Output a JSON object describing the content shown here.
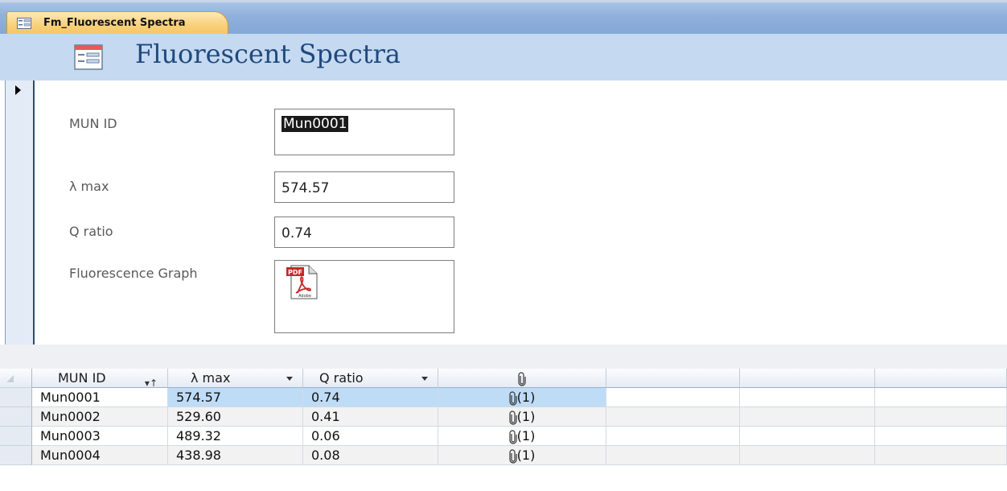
{
  "tab": {
    "label": "Fm_Fluorescent Spectra",
    "icon": "form-icon"
  },
  "header": {
    "title": "Fluorescent Spectra",
    "icon": "form-icon"
  },
  "form": {
    "mun_id": {
      "label": "MUN ID",
      "value": "Mun0001"
    },
    "lambda_max": {
      "label": "λ max",
      "value": "574.57"
    },
    "q_ratio": {
      "label": "Q ratio",
      "value": "0.74"
    },
    "graph": {
      "label": "Fluorescence Graph",
      "attachment_icon": "pdf-icon"
    }
  },
  "datasheet": {
    "columns": [
      "MUN ID",
      "λ max",
      "Q ratio",
      ""
    ],
    "attachment_column_icon": "paperclip-icon",
    "rows": [
      {
        "mun_id": "Mun0001",
        "lambda_max": "574.57",
        "q_ratio": "0.74",
        "attachments": "(1)"
      },
      {
        "mun_id": "Mun0002",
        "lambda_max": "529.60",
        "q_ratio": "0.41",
        "attachments": "(1)"
      },
      {
        "mun_id": "Mun0003",
        "lambda_max": "489.32",
        "q_ratio": "0.06",
        "attachments": "(1)"
      },
      {
        "mun_id": "Mun0004",
        "lambda_max": "438.98",
        "q_ratio": "0.08",
        "attachments": "(1)"
      }
    ]
  },
  "colors": {
    "header_bg": "#c5d9f1",
    "title": "#1f497d",
    "tab": "#f9d07b",
    "selected_row": "#bfdcf6"
  }
}
